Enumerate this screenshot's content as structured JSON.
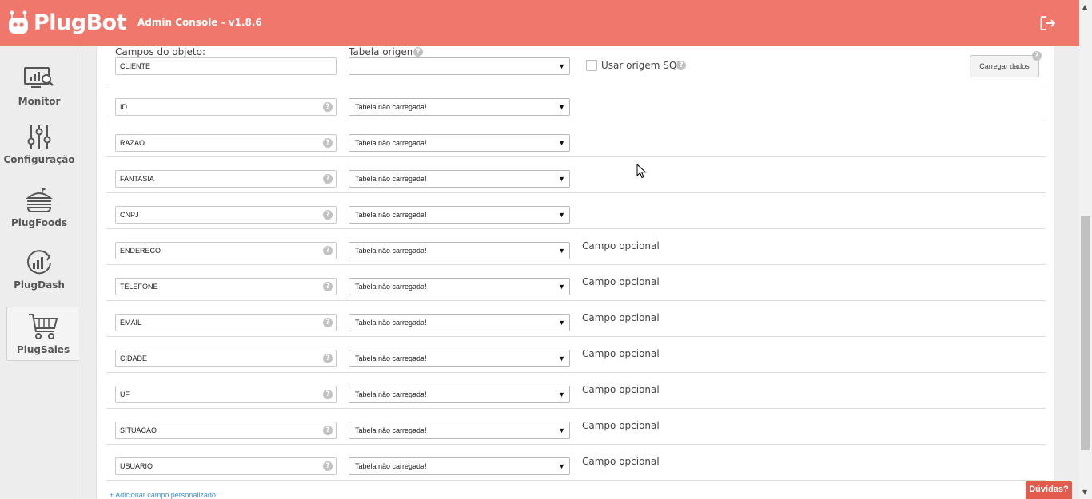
{
  "app": {
    "brand": "PlugBot",
    "title": "Admin Console - v1.8.6"
  },
  "header": {
    "logout_icon": "logout-icon"
  },
  "sidebar": {
    "items": [
      {
        "label": "Monitor",
        "icon": "monitor-icon"
      },
      {
        "label": "Configuração",
        "icon": "sliders-icon"
      },
      {
        "label": "PlugFoods",
        "icon": "burger-icon"
      },
      {
        "label": "PlugDash",
        "icon": "dashboard-icon"
      },
      {
        "label": "PlugSales",
        "icon": "cart-icon",
        "active": true
      }
    ]
  },
  "form": {
    "object_fields_label": "Campos do objeto:",
    "object_name": "CLIENTE",
    "source_table_label": "Tabela origem:",
    "source_table_value": "",
    "use_sql_label": "Usar origem SQL",
    "use_sql_checked": false,
    "load_button": "Carregar dados"
  },
  "fields": [
    {
      "name": "ID",
      "mapping": "Tabela não carregada!",
      "note": ""
    },
    {
      "name": "RAZAO",
      "mapping": "Tabela não carregada!",
      "note": ""
    },
    {
      "name": "FANTASIA",
      "mapping": "Tabela não carregada!",
      "note": ""
    },
    {
      "name": "CNPJ",
      "mapping": "Tabela não carregada!",
      "note": ""
    },
    {
      "name": "ENDERECO",
      "mapping": "Tabela não carregada!",
      "note": "Campo opcional"
    },
    {
      "name": "TELEFONE",
      "mapping": "Tabela não carregada!",
      "note": "Campo opcional"
    },
    {
      "name": "EMAIL",
      "mapping": "Tabela não carregada!",
      "note": "Campo opcional"
    },
    {
      "name": "CIDADE",
      "mapping": "Tabela não carregada!",
      "note": "Campo opcional"
    },
    {
      "name": "UF",
      "mapping": "Tabela não carregada!",
      "note": "Campo opcional"
    },
    {
      "name": "SITUACAO",
      "mapping": "Tabela não carregada!",
      "note": "Campo opcional"
    },
    {
      "name": "USUARIO",
      "mapping": "Tabela não carregada!",
      "note": "Campo opcional"
    }
  ],
  "add_custom_field": "+ Adicionar campo personalizado",
  "help_button": "Dúvidas?",
  "colors": {
    "header": "#f0776c",
    "accent": "#e25b4d",
    "link": "#3c8fd8"
  }
}
